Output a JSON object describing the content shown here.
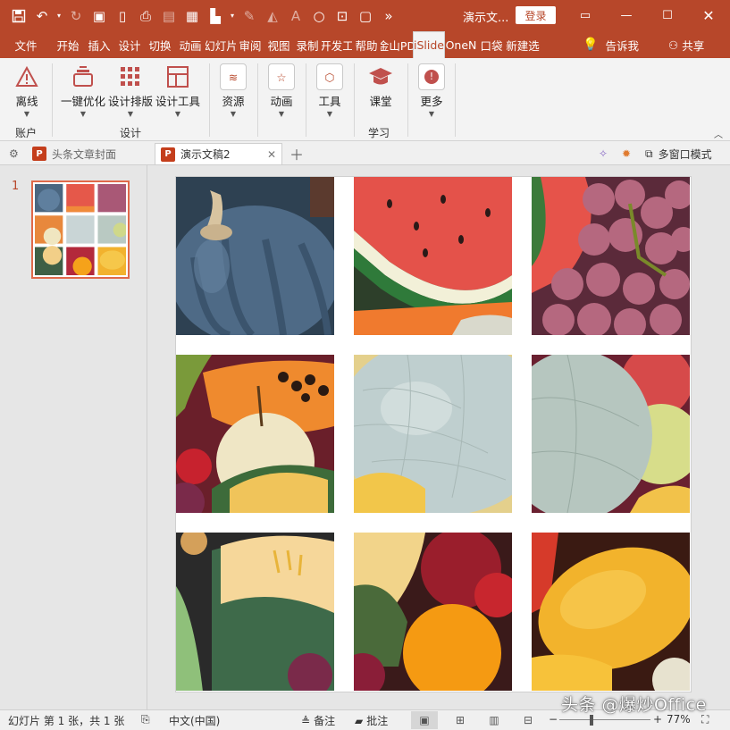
{
  "app": {
    "doc_title": "演示文...",
    "login_label": "登录"
  },
  "menu_tabs": [
    "文件",
    "开始",
    "插入",
    "设计",
    "切换",
    "动画",
    "幻灯片",
    "审阅",
    "视图",
    "录制",
    "开发工",
    "帮助",
    "金山PD",
    "iSlide",
    "OneN",
    "口袋",
    "新建选"
  ],
  "active_tab": "iSlide",
  "tell_me": "告诉我",
  "share": "共享",
  "ribbon": {
    "offline": "离线",
    "group_account": "账户",
    "one_click_optimize": "一键优化",
    "design_layout": "设计排版",
    "design_tools": "设计工具",
    "group_design": "设计",
    "resources": "资源",
    "animation": "动画",
    "tools": "工具",
    "classroom": "课堂",
    "group_learn": "学习",
    "more": "更多"
  },
  "doc_tabs": {
    "tab1": "头条文章封面",
    "tab2": "演示文稿2",
    "multi_window": "多窗口模式"
  },
  "slides_pane": {
    "slide_number": "1"
  },
  "status_bar": {
    "slide_info": "幻灯片 第 1 张，共 1 张",
    "language": "中文(中国)",
    "notes": "备注",
    "comments": "批注",
    "zoom": "77%"
  },
  "watermark": "头条 @爆炒Office",
  "colors": {
    "accent": "#b7472a",
    "ribbon_bg": "#f3f3f3",
    "thumb_border": "#e0694a"
  },
  "slide_tiles": [
    "pumpkin",
    "watermelon",
    "grapes",
    "papaya",
    "cantaloupe",
    "melon-apple",
    "melon-slice",
    "oranges",
    "mango"
  ]
}
